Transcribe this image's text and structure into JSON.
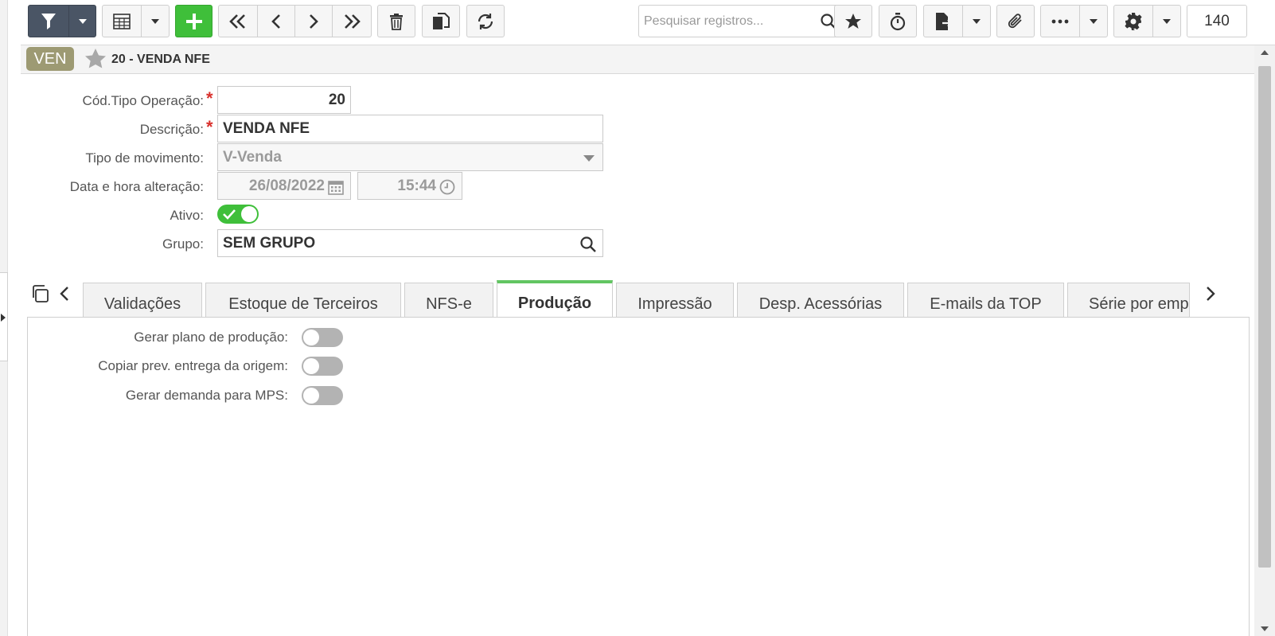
{
  "toolbar": {
    "search_placeholder": "Pesquisar registros...",
    "record_count": "140"
  },
  "header": {
    "badge": "VEN",
    "title": "20 - VENDA NFE"
  },
  "form": {
    "cod_tipo_label": "Cód.Tipo Operação:",
    "cod_tipo_value": "20",
    "descricao_label": "Descrição:",
    "descricao_value": "VENDA NFE",
    "tipo_mov_label": "Tipo de movimento:",
    "tipo_mov_value": "V-Venda",
    "data_hora_label": "Data e hora alteração:",
    "date_value": "26/08/2022",
    "time_value": "15:44",
    "ativo_label": "Ativo:",
    "ativo_on": true,
    "grupo_label": "Grupo:",
    "grupo_value": "SEM GRUPO"
  },
  "tabs": [
    {
      "label": "Validações"
    },
    {
      "label": "Estoque de Terceiros"
    },
    {
      "label": "NFS-e"
    },
    {
      "label": "Produção"
    },
    {
      "label": "Impressão"
    },
    {
      "label": "Desp. Acessórias"
    },
    {
      "label": "E-mails da TOP"
    },
    {
      "label": "Série por emp"
    }
  ],
  "active_tab": "Produção",
  "producao": {
    "gerar_plano_label": "Gerar plano de produção:",
    "copiar_prev_label": "Copiar prev. entrega da origem:",
    "gerar_demanda_label": "Gerar demanda para MPS:"
  },
  "colors": {
    "accent_green": "#3fbf3a",
    "tab_active_border": "#62c562",
    "badge": "#9d9a73",
    "required": "#d9302c",
    "dark_button": "#4a5565"
  }
}
